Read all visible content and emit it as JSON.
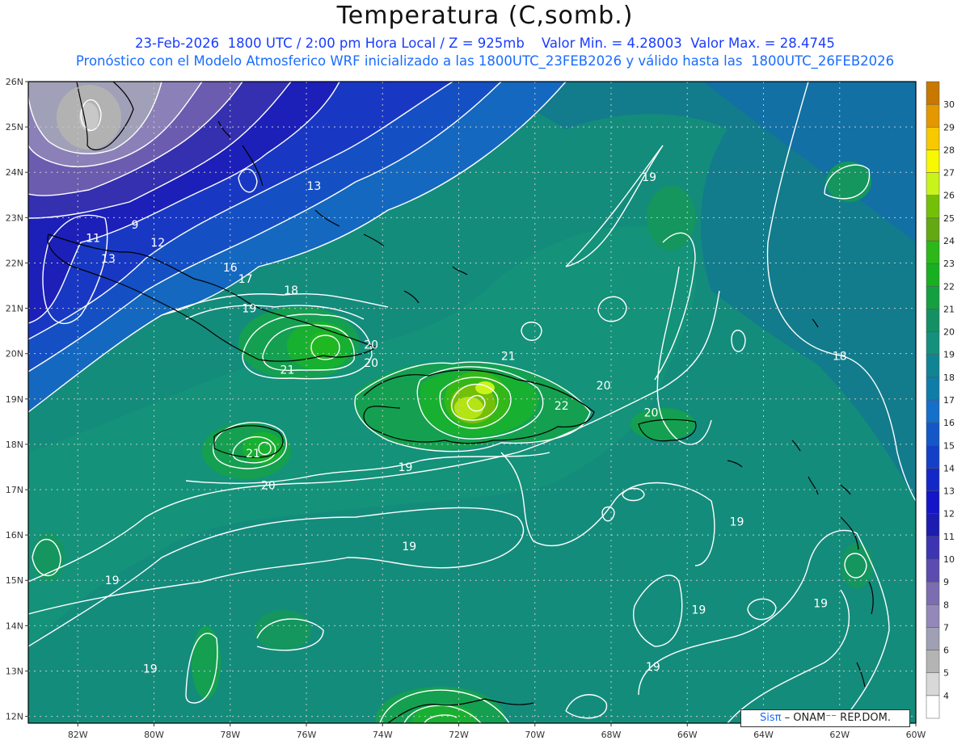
{
  "title": "Temperatura (C,somb.)",
  "subtitle_line1": "23-Feb-2026  1800 UTC / 2:00 pm Hora Local / Z = 925mb    Valor Min. = 4.28003  Valor Max. = 28.4745",
  "subtitle_line2": "Pronóstico con el Modelo Atmosferico WRF inicializado a las 1800UTC_23FEB2026 y válido hasta las  1800UTC_26FEB2026",
  "badge": {
    "sis": "Sisπ",
    "onamet": " – ONAM⁻⁻ REP.DOM."
  },
  "lat_labels": [
    "26N",
    "25N",
    "24N",
    "23N",
    "22N",
    "21N",
    "20N",
    "19N",
    "18N",
    "17N",
    "16N",
    "15N",
    "14N",
    "13N",
    "12N"
  ],
  "lon_labels": [
    "82W",
    "80W",
    "78W",
    "76W",
    "74W",
    "72W",
    "70W",
    "68W",
    "66W",
    "64W",
    "62W",
    "60W"
  ],
  "colorbar": {
    "levels": [
      "4",
      "5",
      "6",
      "7",
      "8",
      "9",
      "10",
      "11",
      "12",
      "13",
      "14",
      "15",
      "16",
      "17",
      "18",
      "19",
      "20",
      "21",
      "22",
      "23",
      "24",
      "25",
      "26",
      "27",
      "28",
      "29",
      "30"
    ],
    "colors": [
      "#ffffff",
      "#d8d8d8",
      "#b4b4b4",
      "#a0a0b4",
      "#9488b8",
      "#7c6cb0",
      "#5c4cb0",
      "#3c34b0",
      "#1c1cb0",
      "#1414c8",
      "#1428c8",
      "#1440c8",
      "#1458c8",
      "#1470c8",
      "#107ca8",
      "#108494",
      "#14907c",
      "#149064",
      "#14a040",
      "#18b020",
      "#2cb818",
      "#64a814",
      "#74c008",
      "#c8f41c",
      "#f8f800",
      "#f8c800",
      "#e49800",
      "#c87800"
    ]
  },
  "contour_labels": [
    {
      "text": "13",
      "lon": -75.8,
      "lat": 23.7
    },
    {
      "text": "9",
      "lon": -80.5,
      "lat": 22.85
    },
    {
      "text": "11",
      "lon": -81.6,
      "lat": 22.55
    },
    {
      "text": "12",
      "lon": -79.9,
      "lat": 22.45
    },
    {
      "text": "13",
      "lon": -81.2,
      "lat": 22.1
    },
    {
      "text": "16",
      "lon": -78.0,
      "lat": 21.9
    },
    {
      "text": "17",
      "lon": -77.6,
      "lat": 21.65
    },
    {
      "text": "18",
      "lon": -76.4,
      "lat": 21.4
    },
    {
      "text": "19",
      "lon": -77.5,
      "lat": 21.0
    },
    {
      "text": "20",
      "lon": -74.3,
      "lat": 20.2
    },
    {
      "text": "20",
      "lon": -74.3,
      "lat": 19.8
    },
    {
      "text": "21",
      "lon": -76.5,
      "lat": 19.65
    },
    {
      "text": "21",
      "lon": -70.7,
      "lat": 19.95
    },
    {
      "text": "22",
      "lon": -69.3,
      "lat": 18.85
    },
    {
      "text": "20",
      "lon": -68.2,
      "lat": 19.3
    },
    {
      "text": "20",
      "lon": -66.95,
      "lat": 18.7
    },
    {
      "text": "19",
      "lon": -67.0,
      "lat": 23.9
    },
    {
      "text": "18",
      "lon": -62.0,
      "lat": 19.95
    },
    {
      "text": "21",
      "lon": -77.4,
      "lat": 17.8
    },
    {
      "text": "20",
      "lon": -77.0,
      "lat": 17.1
    },
    {
      "text": "19",
      "lon": -73.4,
      "lat": 17.5
    },
    {
      "text": "19",
      "lon": -73.3,
      "lat": 15.75
    },
    {
      "text": "19",
      "lon": -64.7,
      "lat": 16.3
    },
    {
      "text": "19",
      "lon": -81.1,
      "lat": 15.0
    },
    {
      "text": "19",
      "lon": -65.7,
      "lat": 14.35
    },
    {
      "text": "19",
      "lon": -62.5,
      "lat": 14.5
    },
    {
      "text": "19",
      "lon": -80.1,
      "lat": 13.05
    },
    {
      "text": "19",
      "lon": -66.9,
      "lat": 13.1
    }
  ],
  "domain": {
    "lon_min": -83.3,
    "lon_max": -60.0,
    "lat_min": 11.85,
    "lat_max": 26.0
  },
  "field_min": 4.28003,
  "field_max": 28.4745
}
